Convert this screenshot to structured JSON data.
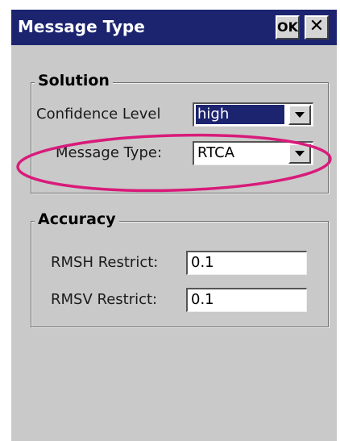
{
  "window": {
    "title": "Message Type",
    "ok_label": "OK",
    "close_label": "✕"
  },
  "solution": {
    "legend": "Solution",
    "confidence_label": "Confidence Level",
    "confidence_value": "high",
    "message_type_label": "Message Type:",
    "message_type_value": "RTCA"
  },
  "accuracy": {
    "legend": "Accuracy",
    "rmsh_label": "RMSH Restrict:",
    "rmsh_value": "0.1",
    "rmsv_label": "RMSV Restrict:",
    "rmsv_value": "0.1"
  },
  "colors": {
    "titlebar": "#1c2470",
    "window_background": "#c9c9c9",
    "annotation_ellipse": "#d81b7a"
  },
  "icons": {
    "dropdown": "chevron-down-icon",
    "close": "close-icon"
  }
}
